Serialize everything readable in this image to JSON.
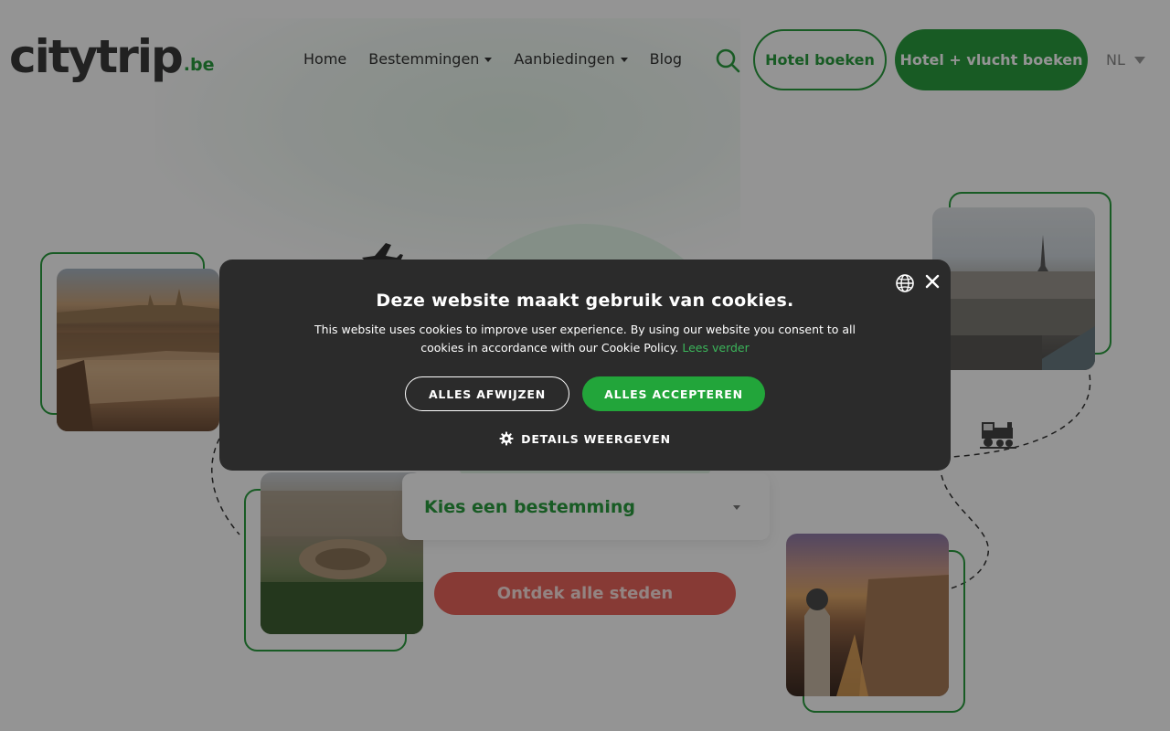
{
  "brand": {
    "logo_text": "citytrip",
    "logo_tld": ".be"
  },
  "nav": {
    "items": [
      {
        "label": "Home",
        "dropdown": false
      },
      {
        "label": "Bestemmingen",
        "dropdown": true
      },
      {
        "label": "Aanbiedingen",
        "dropdown": true
      },
      {
        "label": "Blog",
        "dropdown": false
      }
    ]
  },
  "header": {
    "search_icon": "search-icon",
    "hotel_button": "Hotel boeken",
    "hotel_flight_button": "Hotel + vlucht boeken",
    "language": "NL"
  },
  "hero": {
    "destination_select": "Kies een bestemming",
    "discover_button": "Ontdek alle steden",
    "decor_icons": [
      "plane-icon",
      "train-icon"
    ]
  },
  "cookie_banner": {
    "title": "Deze website maakt gebruik van cookies.",
    "text": "This website uses cookies to improve user experience. By using our website you consent to all cookies in accordance with our Cookie Policy.",
    "link": "Lees verder",
    "reject": "ALLES AFWIJZEN",
    "accept": "ALLES ACCEPTEREN",
    "details": "DETAILS WEERGEVEN",
    "icons": [
      "globe-icon",
      "close-icon",
      "gear-icon"
    ]
  },
  "colors": {
    "brand_green": "#2a9d3f",
    "accept_green": "#22a53a",
    "cta_red": "#e8655c",
    "dialog_bg": "#2b2b2b",
    "logo_dark": "#3a3a3a"
  }
}
